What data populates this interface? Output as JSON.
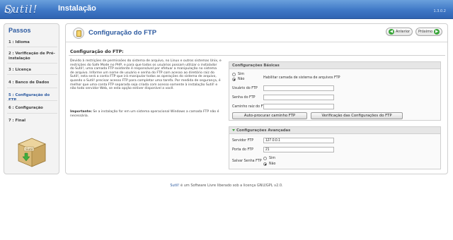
{
  "header": {
    "logo_text": "Sutil!",
    "app_title": "Instalação",
    "version": "1.3.0.2"
  },
  "sidebar": {
    "title": "Passos",
    "steps": [
      {
        "label": "1 : Idioma"
      },
      {
        "label": "2 : Verificação de Pré-instalação"
      },
      {
        "label": "3 : Licença"
      },
      {
        "label": "4 : Banco de Dados"
      },
      {
        "label": "5 : Configuração do FTP"
      },
      {
        "label": "6 : Configuração"
      },
      {
        "label": "7 : Final"
      }
    ],
    "active_step": 5,
    "box_label": "Sutil"
  },
  "main": {
    "title": "Configuração do FTP",
    "prev_label": "Anterior",
    "next_label": "Próximo",
    "section_title": "Configuração do FTP:",
    "description": "Devido à restrições de permissões do sistema de arquivo, no Linux e outros sistemas Unix, e restrições do Safe Mode no PHP, e para que todos os usuários possam utilizar o instalador do Sutil!, uma camada FTP existente é responsável por efetuar a manipulação no sistema de arquivo. Informe um nome de usuário e senha do FTP com acesso ao diretório raiz do Sutil!, esta será a conta FTP que irá manipular todas as operações do sistema de arquivo, quando o Sutil! precisar acesso FTP para completar uma tarefa. Por medida de segurança, é melhor que uma conta FTP separada seja criada com acesso somente à instalação Sutil! e não todo servidor Web, se esta opção estiver disponível a você.",
    "important_label": "Importante:",
    "important_text": "Se a instalação for em um sistema operacional Windows a camada FTP não é necessária.",
    "important_bold_word": "não"
  },
  "basic": {
    "title": "Configurações Básicas",
    "radio_yes": "Sim",
    "radio_no": "Não",
    "enable_label": "Habilitar camada de sistema de arquivos FTP",
    "user_label": "Usuário do FTP",
    "user_value": "",
    "pass_label": "Senha do FTP",
    "pass_value": "",
    "root_label": "Caminho raiz do FTP",
    "root_value": "",
    "auto_button": "Auto-procurar caminho FTP",
    "verify_button": "Verificação das Configurações do FTP"
  },
  "advanced": {
    "title": "Configurações Avançadas",
    "server_label": "Servidor FTP",
    "server_value": "127.0.0.1",
    "port_label": "Porta do FTP",
    "port_value": "21",
    "save_label": "Salvar Senha FTP",
    "save_yes": "Sim",
    "save_no": "Não"
  },
  "footer": {
    "brand": "Sutil!",
    "text": " é um Software Livre liberado sob a licença GNU/GPL v2.0."
  },
  "colors": {
    "header_blue": "#3f78c6",
    "title_blue": "#2c5aa0",
    "green": "#3aa53a"
  }
}
